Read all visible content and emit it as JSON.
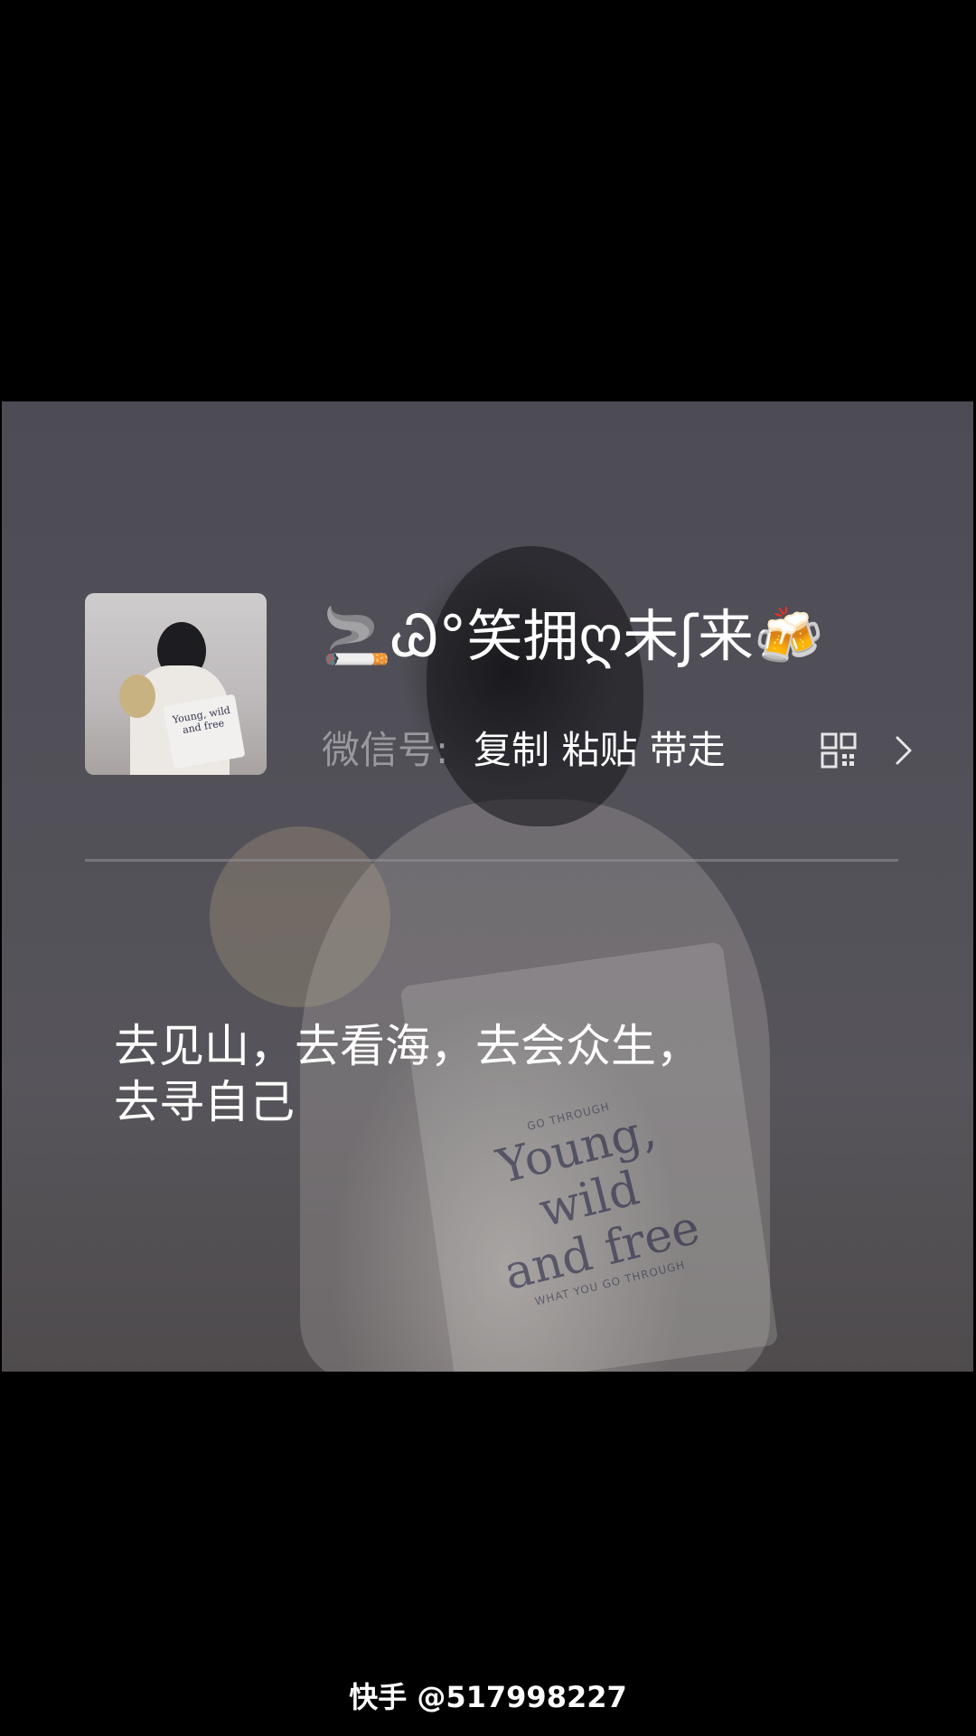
{
  "profile": {
    "nickname": "🚬Ꮚ°笑拥ღ未ʃ来🍻",
    "wechat_label": "微信号:",
    "wechat_value": "复制 粘贴 带走"
  },
  "signature": {
    "line1": "去见山，去看海，去会众生，",
    "line2": "去寻自己"
  },
  "photo_print": {
    "bag_text_1": "Young, wild",
    "bag_text_2": "and free",
    "bag_small_top": "GO THROUGH",
    "bag_small_bottom": "WHAT YOU GO THROUGH"
  },
  "watermark": {
    "text": "快手 @517998227"
  },
  "icons": {
    "qr": "qr-code-icon",
    "chevron": "chevron-right-icon"
  }
}
